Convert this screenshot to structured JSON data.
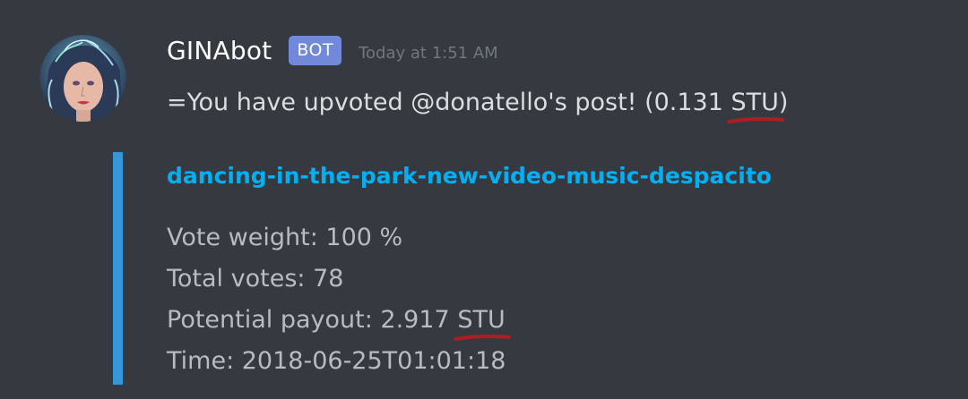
{
  "message": {
    "author": {
      "username": "GINAbot",
      "bot_tag": "BOT",
      "avatar_icon": "avatar-icon"
    },
    "timestamp": "Today at 1:51 AM",
    "content": {
      "prefix": "=You have upvoted @donatello's post! (0.131 ",
      "unit": "STU",
      "suffix": ")"
    },
    "embed": {
      "accent_color": "#3498db",
      "title": "dancing-in-the-park-new-video-music-despacito",
      "vote_weight": "Vote weight: 100 %",
      "total_votes": "Total votes: 78",
      "payout_prefix": "Potential payout: 2.917 ",
      "payout_unit": "STU",
      "time": "Time: 2018-06-25T01:01:18"
    },
    "annotation_color": "#b01c23"
  }
}
